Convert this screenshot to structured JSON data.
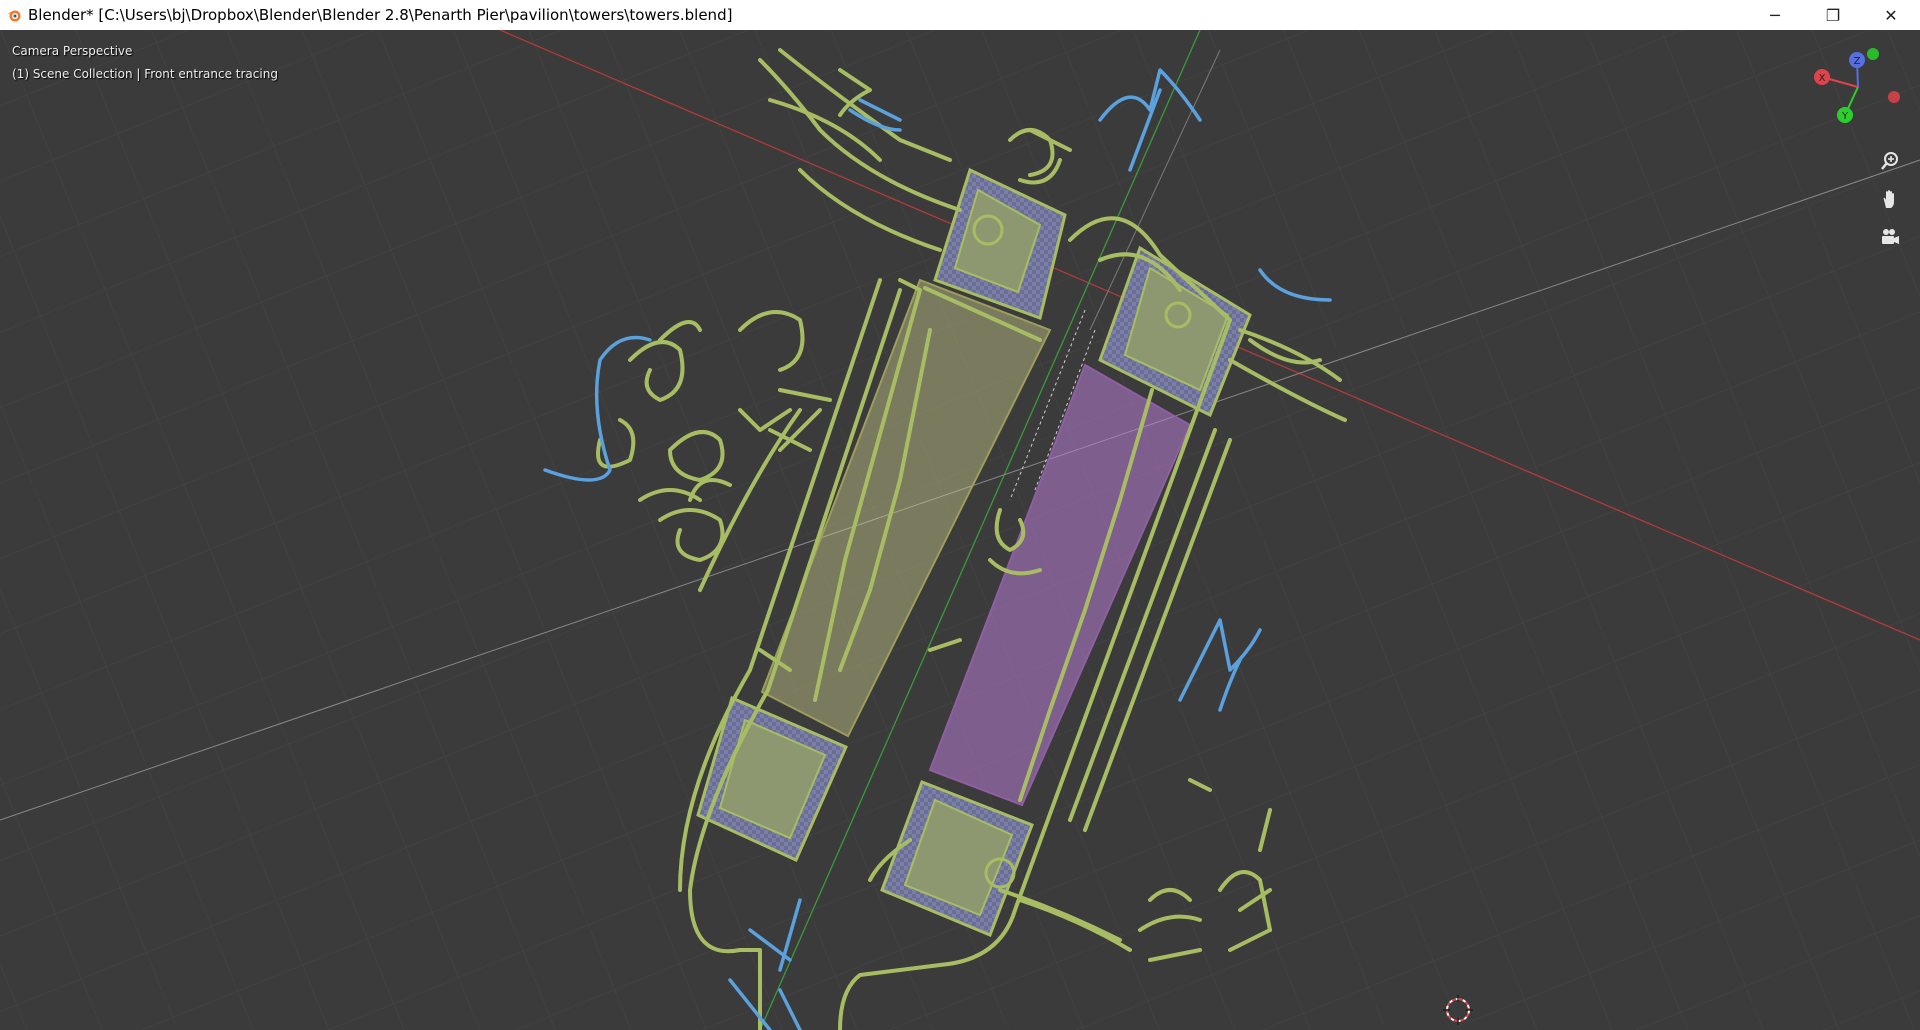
{
  "window": {
    "title": "Blender* [C:\\Users\\bj\\Dropbox\\Blender\\Blender 2.8\\Penarth Pier\\pavilion\\towers\\towers.blend]",
    "controls": {
      "minimize": "─",
      "maximize": "❐",
      "close": "✕"
    }
  },
  "viewport": {
    "view_name": "Camera Perspective",
    "collection_info": "(1) Scene Collection | Front entrance tracing"
  },
  "gizmo": {
    "x_label": "X",
    "y_label": "Y",
    "z_label": "Z"
  },
  "colors": {
    "x_axis": "#e2424b",
    "y_axis": "#2bd02b",
    "z_axis": "#5670e4",
    "annotation_green": "#a8bd63",
    "annotation_blue": "#5aa1dd",
    "yellow_plane": "#c8c88a",
    "purple_plane": "#b77cd2",
    "background": "#3b3b3b"
  },
  "tools": [
    "zoom-icon",
    "pan-hand-icon",
    "camera-icon"
  ]
}
